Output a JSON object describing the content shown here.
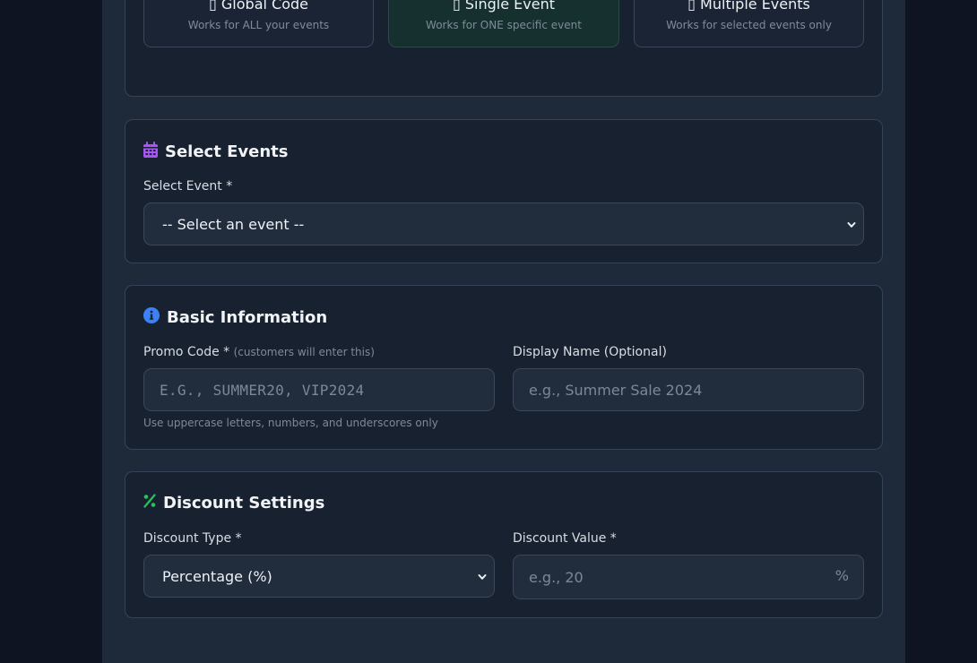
{
  "scope": {
    "options": [
      {
        "icon": "globe-icon",
        "label": "Global Code",
        "description": "Works for ALL your events",
        "selected": false,
        "accent": "#3b82f6"
      },
      {
        "icon": "ticket-icon",
        "label": "Single Event",
        "description": "Works for ONE specific event",
        "selected": true,
        "accent": "#22c55e"
      },
      {
        "icon": "layers-icon",
        "label": "Multiple Events",
        "description": "Works for selected events only",
        "selected": false,
        "accent": "#f97316"
      }
    ],
    "glyph": "▯"
  },
  "select_events": {
    "title": "Select Events",
    "icon": "calendar-icon",
    "icon_color": "#a855f7",
    "event_label": "Select Event *",
    "event_value": "-- Select an event --"
  },
  "basic_info": {
    "title": "Basic Information",
    "icon": "info-icon",
    "icon_color": "#3b82f6",
    "promo_label": "Promo Code *",
    "promo_hint": "(customers will enter this)",
    "promo_placeholder": "E.G., SUMMER20, VIP2024",
    "promo_help": "Use uppercase letters, numbers, and underscores only",
    "display_label": "Display Name (Optional)",
    "display_placeholder": "e.g., Summer Sale 2024"
  },
  "discount": {
    "title": "Discount Settings",
    "icon": "percent-icon",
    "icon_color": "#22c55e",
    "type_label": "Discount Type *",
    "type_value": "Percentage (%)",
    "value_label": "Discount Value *",
    "value_placeholder": "e.g., 20",
    "value_suffix": "%"
  }
}
